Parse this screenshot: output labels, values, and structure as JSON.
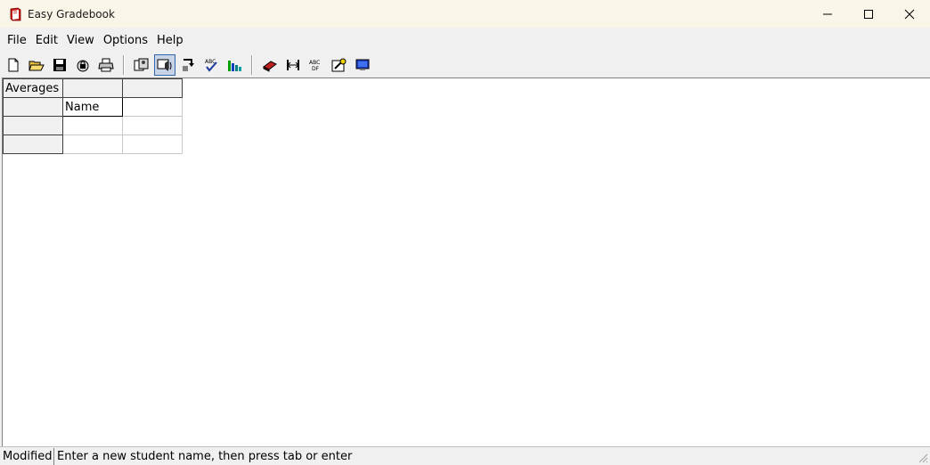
{
  "window": {
    "title": "Easy Gradebook",
    "controls": [
      "minimize-icon",
      "maximize-icon",
      "close-icon"
    ]
  },
  "menu": {
    "items": [
      "File",
      "Edit",
      "View",
      "Options",
      "Help"
    ]
  },
  "toolbar": {
    "buttons": [
      {
        "icon": "new-document-icon"
      },
      {
        "icon": "open-folder-icon"
      },
      {
        "icon": "save-disk-icon"
      },
      {
        "icon": "lock-icon"
      },
      {
        "icon": "print-icon"
      },
      {
        "icon": "students-icon"
      },
      {
        "icon": "speaker-icon",
        "active": true
      },
      {
        "icon": "import-icon"
      },
      {
        "icon": "spellcheck-icon"
      },
      {
        "icon": "bar-chart-icon"
      },
      {
        "icon": "eraser-icon"
      },
      {
        "icon": "column-width-icon"
      },
      {
        "icon": "sort-abc-icon"
      },
      {
        "icon": "grade-scale-icon"
      },
      {
        "icon": "monitor-icon"
      }
    ]
  },
  "grid": {
    "header_row": [
      "Averages",
      "",
      ""
    ],
    "rows": [
      [
        "",
        "Name",
        ""
      ],
      [
        "",
        "",
        ""
      ],
      [
        "",
        "",
        ""
      ]
    ]
  },
  "status": {
    "state": "Modified",
    "message": "Enter a new student name, then press tab or enter"
  }
}
